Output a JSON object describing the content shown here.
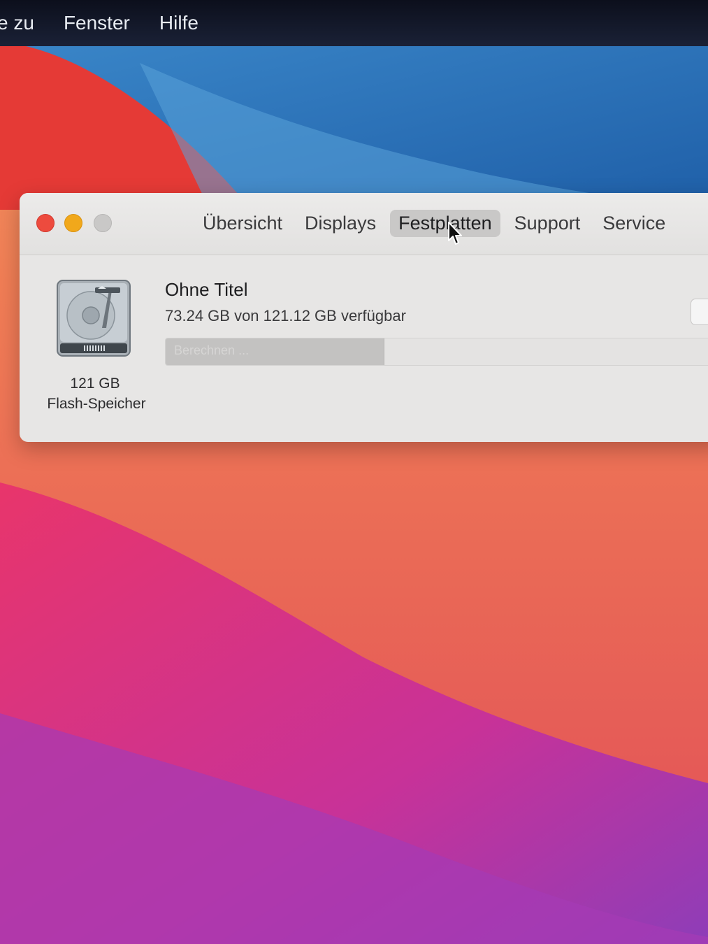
{
  "menubar": {
    "items": [
      "e zu",
      "Fenster",
      "Hilfe"
    ]
  },
  "window": {
    "tabs": [
      {
        "label": "Übersicht",
        "active": false
      },
      {
        "label": "Displays",
        "active": false
      },
      {
        "label": "Festplatten",
        "active": true
      },
      {
        "label": "Support",
        "active": false
      },
      {
        "label": "Service",
        "active": false
      }
    ],
    "disk": {
      "icon": "hard-drive-icon",
      "size": "121 GB",
      "type": "Flash-Speicher"
    },
    "volume": {
      "name": "Ohne Titel",
      "available": "73.24 GB von 121.12 GB verfügbar",
      "used_fraction": 0.395,
      "bar_label": "Berechnen ..."
    }
  },
  "colors": {
    "close": "#ed4b3e",
    "minimize": "#f1a81b",
    "zoom": "#c9c8c7",
    "window_bg": "#e7e6e5",
    "menubar_bg": "#0c0f1c"
  }
}
